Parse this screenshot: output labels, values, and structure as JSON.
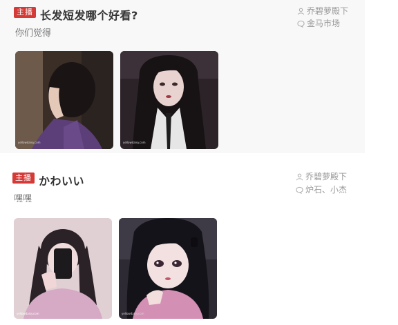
{
  "posts": [
    {
      "badge": "主播",
      "title": "长发短发哪个好看?",
      "subtitle": "你们觉得",
      "author": "乔碧萝殿下",
      "tags": "金马市场",
      "icons": {
        "author": "person-icon",
        "tags": "comment-icon"
      },
      "images": [
        {
          "icon": "photo-short-hair",
          "watermark": "yellowdaisy.com"
        },
        {
          "icon": "photo-long-hair",
          "watermark": "yellowdaisy.com"
        }
      ]
    },
    {
      "badge": "主播",
      "title": "かわいい",
      "subtitle": "嘿嘿",
      "author": "乔碧萝殿下",
      "tags": "炉石、小杰",
      "icons": {
        "author": "person-icon",
        "tags": "comment-icon"
      },
      "images": [
        {
          "icon": "photo-mirror-selfie",
          "watermark": "yellowdaisy.com"
        },
        {
          "icon": "photo-anime-girl",
          "watermark": "yellowdaisy.com"
        }
      ]
    }
  ],
  "colors": {
    "badge": "#d43a37",
    "title": "#333333",
    "meta": "#999999",
    "post_bg": "#f8f8f8"
  }
}
